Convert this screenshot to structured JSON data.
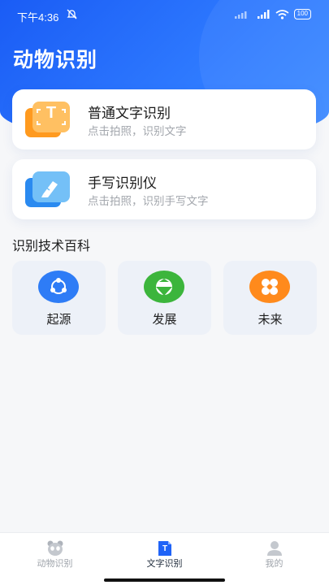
{
  "status_bar": {
    "time": "下午4:36",
    "battery": "100"
  },
  "header": {
    "title": "动物识别"
  },
  "cards": [
    {
      "title": "普通文字识别",
      "subtitle": "点击拍照，识别文字",
      "icon": "text-scan-icon",
      "icon_letter": "T"
    },
    {
      "title": "手写识别仪",
      "subtitle": "点击拍照，识别手写文字",
      "icon": "handwriting-pen-icon"
    }
  ],
  "encyclopedia": {
    "title": "识别技术百科",
    "tiles": [
      {
        "label": "起源",
        "icon": "network-icon",
        "color": "#2e7cf6"
      },
      {
        "label": "发展",
        "icon": "growth-icon",
        "color": "#3cb53c"
      },
      {
        "label": "未来",
        "icon": "future-icon",
        "color": "#ff8a1c"
      }
    ]
  },
  "tabbar": {
    "tabs": [
      {
        "label": "动物识别",
        "icon": "panda-icon",
        "active": false
      },
      {
        "label": "文字识别",
        "icon": "text-doc-icon",
        "icon_letter": "T",
        "active": true
      },
      {
        "label": "我的",
        "icon": "user-icon",
        "active": false
      }
    ]
  },
  "colors": {
    "primary": "#1f63f7",
    "background": "#f6f7f9"
  }
}
